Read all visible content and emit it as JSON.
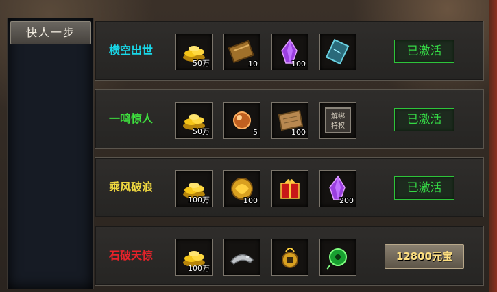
{
  "sidebar": {
    "tab_label": "快人一步"
  },
  "rows": [
    {
      "title": "横空出世",
      "title_color": "#19d7e8",
      "items": [
        {
          "icon": "gold-coins-icon",
          "qty": "50万"
        },
        {
          "icon": "wooden-token-icon",
          "qty": "10"
        },
        {
          "icon": "purple-crystal-icon",
          "qty": "100"
        },
        {
          "icon": "blue-scroll-icon",
          "qty": ""
        }
      ],
      "button": {
        "label": "已激活",
        "type": "activated"
      }
    },
    {
      "title": "一鸣惊人",
      "title_color": "#3ee23e",
      "items": [
        {
          "icon": "gold-coins-icon",
          "qty": "50万"
        },
        {
          "icon": "orb-icon",
          "qty": "5"
        },
        {
          "icon": "parchment-icon",
          "qty": "100"
        },
        {
          "icon": "unbind-privilege-icon",
          "qty": "",
          "text": "解绑特权"
        }
      ],
      "button": {
        "label": "已激活",
        "type": "activated"
      }
    },
    {
      "title": "乘风破浪",
      "title_color": "#f0d840",
      "items": [
        {
          "icon": "gold-coins-icon",
          "qty": "100万"
        },
        {
          "icon": "gold-medal-icon",
          "qty": "100"
        },
        {
          "icon": "red-gift-box-icon",
          "qty": ""
        },
        {
          "icon": "purple-crystal-icon",
          "qty": "200"
        }
      ],
      "button": {
        "label": "已激活",
        "type": "activated"
      }
    },
    {
      "title": "石破天惊",
      "title_color": "#e8222a",
      "items": [
        {
          "icon": "gold-coins-icon",
          "qty": "100万"
        },
        {
          "icon": "silver-helmet-icon",
          "qty": ""
        },
        {
          "icon": "gold-amulet-icon",
          "qty": ""
        },
        {
          "icon": "green-jade-icon",
          "qty": ""
        }
      ],
      "button": {
        "label": "12800元宝",
        "type": "buy"
      }
    }
  ]
}
